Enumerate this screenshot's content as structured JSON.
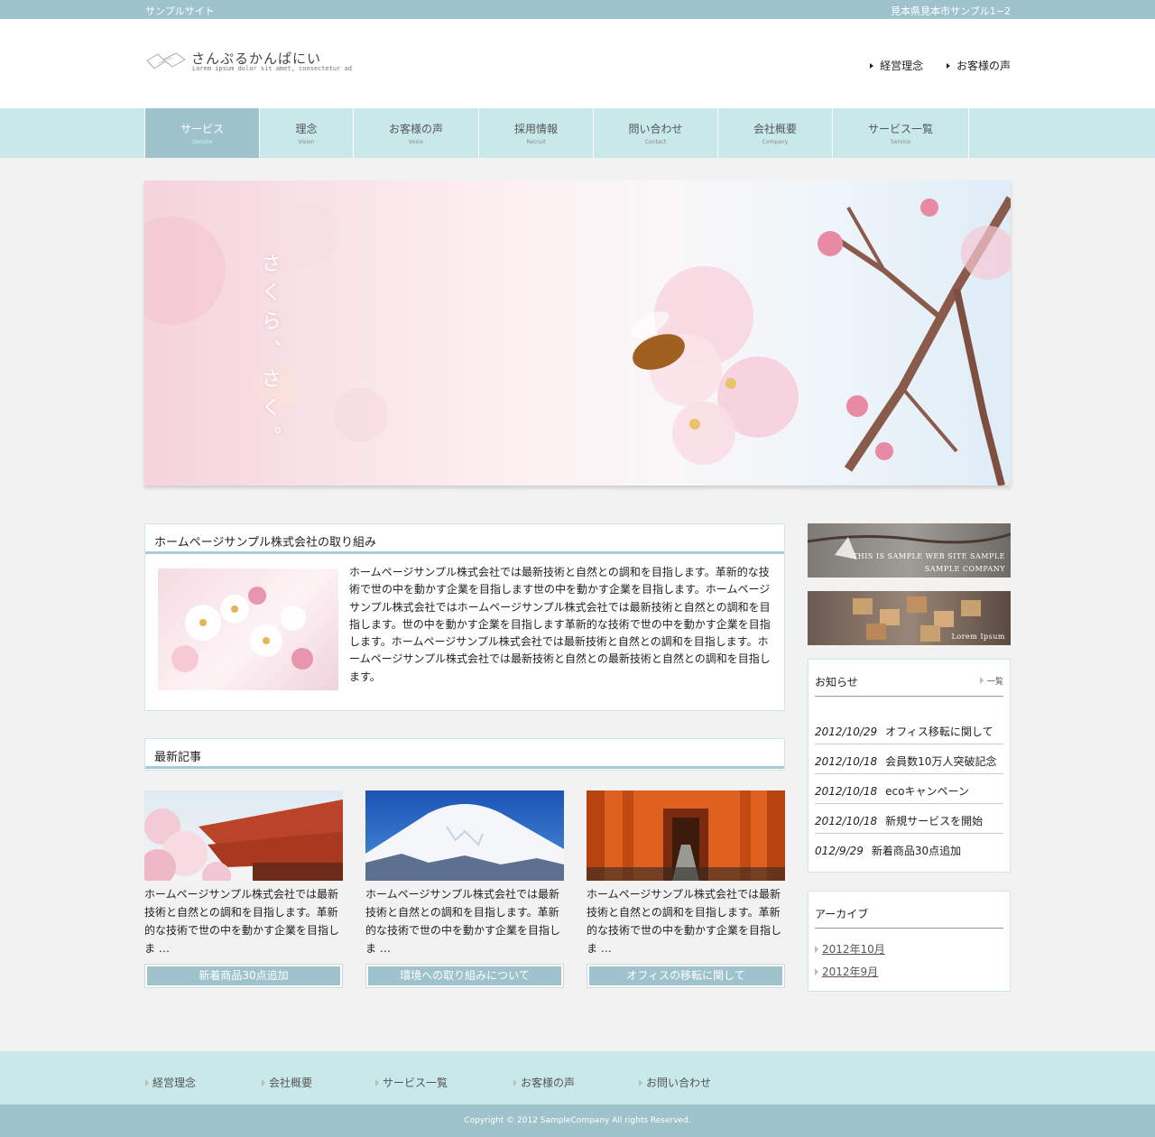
{
  "topbar": {
    "site_name": "サンプルサイト",
    "address": "見本県見本市サンプル1−2"
  },
  "header": {
    "logo_title": "さんぷるかんぱにい",
    "logo_sub": "Lorem ipsum dolor sit amet, consectetur ad",
    "links": [
      "経営理念",
      "お客様の声"
    ]
  },
  "nav": [
    {
      "jp": "サービス",
      "en": "Service"
    },
    {
      "jp": "理念",
      "en": "Vision"
    },
    {
      "jp": "お客様の声",
      "en": "Voice"
    },
    {
      "jp": "採用情報",
      "en": "Recruit"
    },
    {
      "jp": "問い合わせ",
      "en": "Contact"
    },
    {
      "jp": "会社概要",
      "en": "Company"
    },
    {
      "jp": "サービス一覧",
      "en": "Service"
    }
  ],
  "hero": {
    "text": "さくら、さく。"
  },
  "intro": {
    "title": "ホームページサンプル株式会社の取り組み",
    "body": "ホームページサンプル株式会社では最新技術と自然との調和を目指します。革新的な技術で世の中を動かす企業を目指します世の中を動かす企業を目指します。ホームページサンプル株式会社ではホームページサンプル株式会社では最新技術と自然との調和を目指します。世の中を動かす企業を目指します革新的な技術で世の中を動かす企業を目指します。ホームページサンプル株式会社では最新技術と自然との調和を目指します。ホームページサンプル株式会社では最新技術と自然との最新技術と自然との調和を目指します。"
  },
  "latest": {
    "title": "最新記事",
    "cards": [
      {
        "text": "ホームページサンプル株式会社では最新技術と自然との調和を目指します。革新的な技術で世の中を動かす企業を目指しま …",
        "button": "新着商品30点追加"
      },
      {
        "text": "ホームページサンプル株式会社では最新技術と自然との調和を目指します。革新的な技術で世の中を動かす企業を目指しま …",
        "button": "環境への取り組みについて"
      },
      {
        "text": "ホームページサンプル株式会社では最新技術と自然との調和を目指します。革新的な技術で世の中を動かす企業を目指しま …",
        "button": "オフィスの移転に関して"
      }
    ]
  },
  "sidebar": {
    "banner1": {
      "line1": "THIS IS SAMPLE WEB SITE SAMPLE",
      "line2": "SAMPLE COMPANY"
    },
    "banner2": {
      "text": "Lorem Ipsum"
    },
    "news": {
      "title": "お知らせ",
      "more": "一覧",
      "items": [
        {
          "date": "2012/10/29",
          "title": "オフィス移転に関して"
        },
        {
          "date": "2012/10/18",
          "title": "会員数10万人突破記念"
        },
        {
          "date": "2012/10/18",
          "title": "ecoキャンペーン"
        },
        {
          "date": "2012/10/18",
          "title": "新規サービスを開始"
        },
        {
          "date": "012/9/29",
          "title": "新着商品30点追加"
        }
      ]
    },
    "archive": {
      "title": "アーカイブ",
      "items": [
        "2012年10月",
        "2012年9月"
      ]
    }
  },
  "footer": {
    "links": [
      "経営理念",
      "会社概要",
      "サービス一覧",
      "お客様の声",
      "お問い合わせ"
    ],
    "copyright": "Copyright © 2012 SampleCompany All rights Reserved."
  },
  "colors": {
    "accent": "#9fc3cd",
    "nav_bg": "#c9e8ea",
    "page_bg": "#f2f2f2"
  }
}
